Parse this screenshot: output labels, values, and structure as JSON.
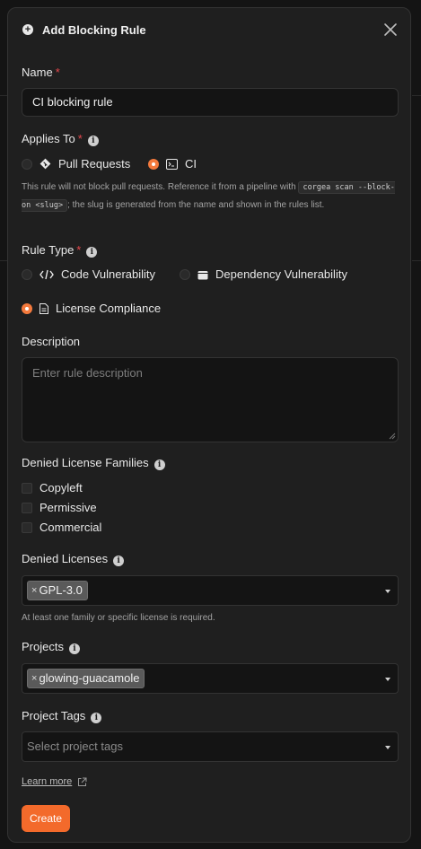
{
  "modal": {
    "title": "Add Blocking Rule"
  },
  "name": {
    "label": "Name",
    "required_mark": "*",
    "value": "CI blocking rule"
  },
  "applies_to": {
    "label": "Applies To",
    "required_mark": "*",
    "options": [
      {
        "label": "Pull Requests",
        "checked": false,
        "icon": "git-diamond-icon"
      },
      {
        "label": "CI",
        "checked": true,
        "icon": "terminal-icon"
      }
    ],
    "helper_before": "This rule will not block pull requests. Reference it from a pipeline with ",
    "helper_code": "corgea scan --block-on <slug>",
    "helper_after": "; the slug is generated from the name and shown in the rules list."
  },
  "rule_type": {
    "label": "Rule Type",
    "required_mark": "*",
    "options": [
      {
        "label": "Code Vulnerability",
        "checked": false,
        "icon": "code-icon"
      },
      {
        "label": "Dependency Vulnerability",
        "checked": false,
        "icon": "package-icon"
      },
      {
        "label": "License Compliance",
        "checked": true,
        "icon": "document-icon"
      }
    ]
  },
  "description": {
    "label": "Description",
    "placeholder": "Enter rule description"
  },
  "denied_families": {
    "label": "Denied License Families",
    "items": [
      "Copyleft",
      "Permissive",
      "Commercial"
    ]
  },
  "denied_licenses": {
    "label": "Denied Licenses",
    "tags": [
      "GPL-3.0"
    ],
    "helper": "At least one family or specific license is required."
  },
  "projects": {
    "label": "Projects",
    "tags": [
      "glowing-guacamole"
    ]
  },
  "project_tags": {
    "label": "Project Tags",
    "placeholder": "Select project tags"
  },
  "footer": {
    "learn_more": "Learn more",
    "create_label": "Create"
  },
  "colors": {
    "accent": "#f36a2b",
    "required": "#e5484d",
    "background": "#1f1f1f"
  }
}
